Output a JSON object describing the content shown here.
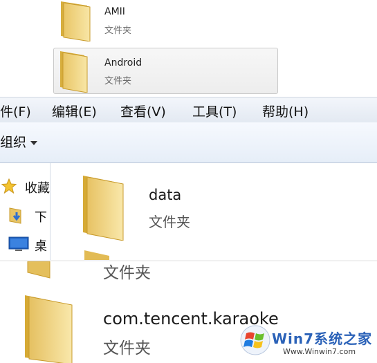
{
  "top_items": [
    {
      "name": "AMII",
      "type": "文件夹"
    },
    {
      "name": "Android",
      "type": "文件夹"
    }
  ],
  "menubar": {
    "items": [
      "件(F)",
      "编辑(E)",
      "查看(V)",
      "工具(T)",
      "帮助(H)"
    ]
  },
  "toolbar": {
    "organize_label": "组织"
  },
  "nav": {
    "items": [
      {
        "label": "收藏",
        "icon": "star-icon"
      },
      {
        "label": "下",
        "icon": "downloads-folder-icon"
      },
      {
        "label": "桌",
        "icon": "desktop-icon"
      }
    ]
  },
  "content": {
    "data_folder": {
      "name": "data",
      "type": "文件夹"
    },
    "partial_folder": {
      "type": "文件夹"
    },
    "karaoke_folder": {
      "name": "com.tencent.karaoke",
      "type": "文件夹"
    }
  },
  "watermark": {
    "brand": "Win7系统之家",
    "url": "Www.Winwin7.com"
  }
}
